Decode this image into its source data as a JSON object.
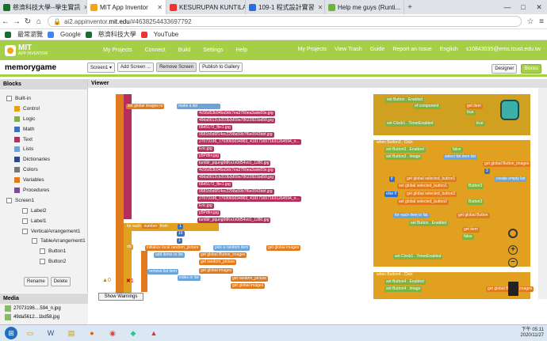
{
  "browser": {
    "tabs": [
      {
        "label": "慈濟科技大學--學生實訊",
        "color": "#1a6e2f"
      },
      {
        "label": "MIT App Inventor",
        "color": "#f7a21b"
      },
      {
        "label": "KESURUPAN KUNTILA...",
        "color": "#e33"
      },
      {
        "label": "109-1 程式設計實習",
        "color": "#2b6fd6"
      },
      {
        "label": "Help me guys (Runti...",
        "color": "#6cb33e"
      }
    ],
    "url_prefix": "ai2.appinventor.",
    "url_domain": "mit.edu",
    "url_suffix": "/#4638254433697792",
    "bookmarks": [
      "最常瀏覽",
      "Google",
      "慈濟科技大學",
      "YouTube"
    ]
  },
  "app": {
    "logo_line1": "MIT",
    "logo_line2": "APP INVENTOR",
    "menu": [
      "My Projects",
      "Connect",
      "Build",
      "Settings",
      "Help"
    ],
    "right_menu": [
      "My Projects",
      "View Trash",
      "Guide",
      "Report an Issue",
      "English",
      "s10843035@ems.tcust.edu.tw"
    ],
    "project_name": "memorygame",
    "screen_select": "Screen1",
    "buttons": [
      "Add Screen ...",
      "Remove Screen",
      "Publish to Gallery"
    ],
    "designer": "Designer",
    "blocks": "Blocks"
  },
  "blocks_panel": {
    "title": "Blocks",
    "items": [
      {
        "label": "Built-in",
        "color": ""
      },
      {
        "label": "Control",
        "color": "#e1a020"
      },
      {
        "label": "Logic",
        "color": "#7fb340"
      },
      {
        "label": "Math",
        "color": "#3f6fb5"
      },
      {
        "label": "Text",
        "color": "#b3305c"
      },
      {
        "label": "Lists",
        "color": "#6aa4d8"
      },
      {
        "label": "Dictionaries",
        "color": "#2b4a8b"
      },
      {
        "label": "Colors",
        "color": "#777"
      },
      {
        "label": "Variables",
        "color": "#e07b1d"
      },
      {
        "label": "Procedures",
        "color": "#7b4aa0"
      },
      {
        "label": "Screen1",
        "color": ""
      },
      {
        "label": "Label2",
        "color": ""
      },
      {
        "label": "Label1",
        "color": ""
      },
      {
        "label": "VerticalArrangement1",
        "color": ""
      },
      {
        "label": "TableArrangement1",
        "color": ""
      },
      {
        "label": "Button1",
        "color": ""
      },
      {
        "label": "Button2",
        "color": ""
      }
    ],
    "rename": "Rename",
    "delete": "Delete"
  },
  "viewer": {
    "title": "Viewer",
    "images_label": "global images",
    "list_items": [
      "4c56d53b94ba9dc7ea3780ea3ade83e.jpg",
      "49da5612cb310b3d59a78622821bd58.jpg",
      "68d5172_fbc1.jpg",
      "9581b5d6f14ec2298a59b7f6e0543bbf.jpg",
      "27073196_1703065034963_4191716571631264594_n...",
      "Eric.jpg",
      "p5Pdtrv.jpg",
      "tumblr_pqung0dKs1x0d54vo1_1280.jpg",
      "4c56d53b94ba9dc7ea3780ea3ade83e.jpg",
      "49da5612cb310b3d59a78622821bd58.jpg",
      "68d5172_fbc1.jpg",
      "9581b5d6f14ec2298a59b7f6e0543bbf.jpg",
      "27073196_1703065034963_4191716571631264594_n...",
      "Eric.jpg",
      "p5Pdtrv.jpg",
      "tumblr_pqung0dKs1x0d54vo1_1280.jpg"
    ],
    "for_each": "for each",
    "number": "number",
    "from": "from",
    "to": "to",
    "by": "by",
    "from_val": "1",
    "to_val": "16",
    "by_val": "1",
    "do": "do",
    "init_local": "initialize local",
    "random_picture": "random_picture",
    "pick_random": "pick a random item",
    "list": "list",
    "add_items": "add items to list",
    "list_word": "list",
    "button_images": "get global Button_images",
    "item": "item",
    "get_random": "get random_picture",
    "remove_list_item": "remove list item",
    "list2": "list",
    "get_images": "get global images",
    "index": "index",
    "index_in_list": "index in list",
    "thing": "thing",
    "get_rp": "get random_picture",
    "get_gi": "get global images",
    "warnings": "Show Warnings",
    "warn_count": "0",
    "err_count": "1",
    "r_set_button": "set Button . Enabled",
    "of_comp": "of component",
    "get_item": "get item",
    "true_val": "true",
    "clock": "set Clock1 . TimerEnabled",
    "when_b3": "when Button3 . Click",
    "set_b3": "set Button3 . Enabled",
    "false_val": "false",
    "set_b3_image": "set Button3 . Image",
    "select_list": "select list item list",
    "get_btn_images": "get global Button_images",
    "index_val": "3",
    "if_word": "if",
    "is_empty": "is list empty?",
    "global_selected1": "get global selected_button1",
    "create_empty": "create empty list",
    "then": "then",
    "set_gsb1": "set global selected_button1",
    "button3": "Button3",
    "else_if": "else if",
    "gsb2": "get global selected_button2",
    "set_gsb2": "set global selected_button2",
    "for_each_item": "for each item in list",
    "get_gb": "get global Button",
    "set_be": "set Button . Enabled",
    "when_b4": "when Button4 . Click",
    "set_b4": "set Button4 . Enabled",
    "set_b4_image": "set Button4 . Image",
    "gb_images": "get global Button_images",
    "index4": "4"
  },
  "media": {
    "title": "Media",
    "files": [
      "27073196....594_n.jpg",
      "49da5612...1bd58.jpg"
    ]
  },
  "taskbar": {
    "time": "下午 05:11",
    "date": "2020/11/27"
  }
}
